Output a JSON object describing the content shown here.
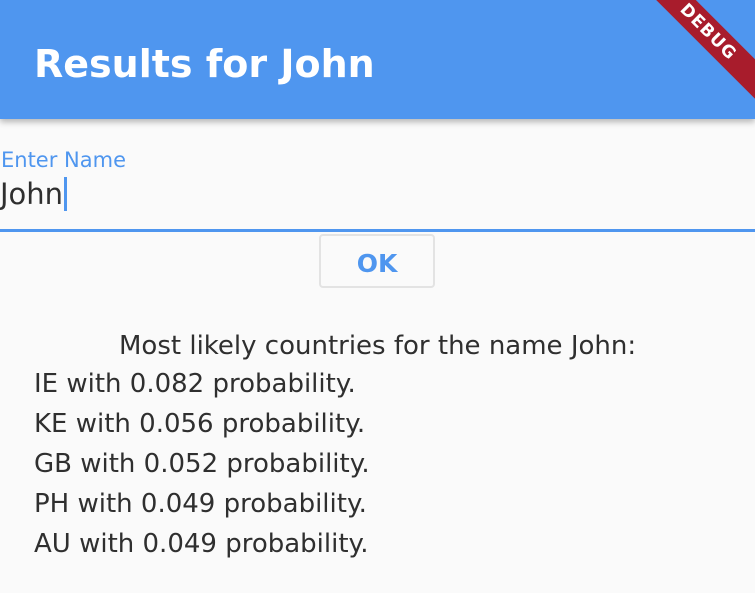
{
  "app_bar": {
    "title": "Results for John",
    "debug_banner": "DEBUG",
    "color": "#4f96ef"
  },
  "name_field": {
    "label": "Enter Name",
    "value": "John"
  },
  "ok_button": {
    "label": "OK"
  },
  "results": {
    "heading": "Most likely countries for the name John:",
    "lines": [
      "IE with 0.082 probability.",
      "KE with 0.056 probability.",
      "GB with 0.052 probability.",
      "PH with 0.049 probability.",
      "AU with 0.049 probability."
    ]
  }
}
